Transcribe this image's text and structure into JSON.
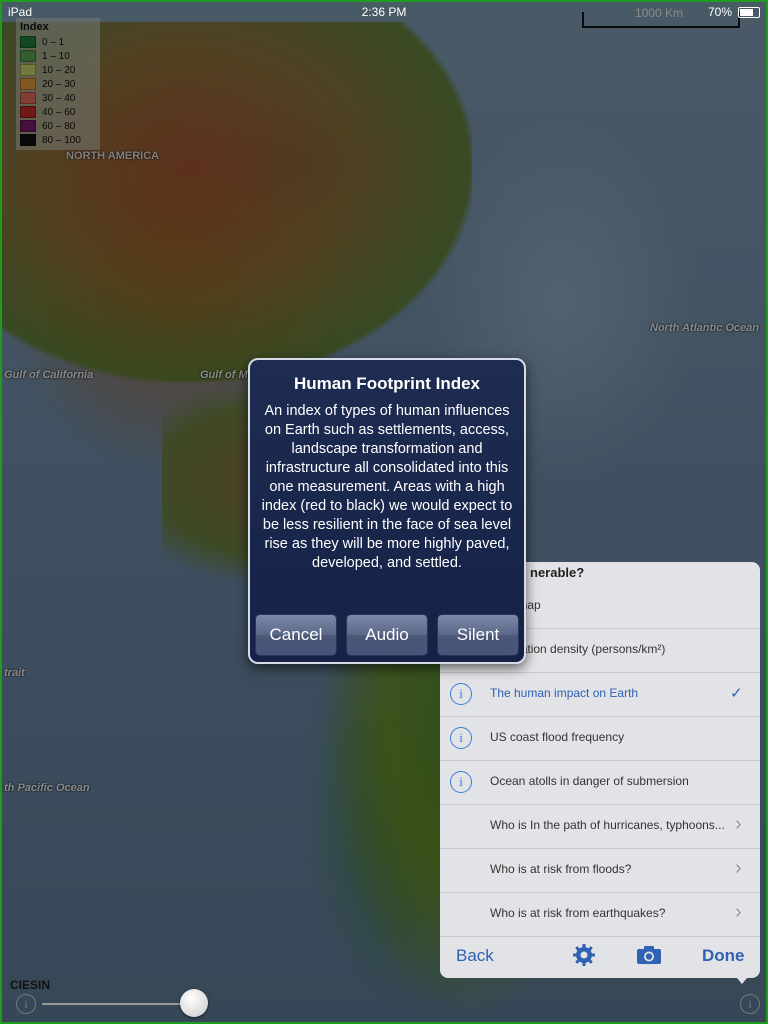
{
  "status_bar": {
    "carrier": "iPad",
    "time": "2:36 PM",
    "battery": "70%",
    "battery_level": 0.7
  },
  "scale_bar": {
    "label": "1000 Km"
  },
  "legend": {
    "title": "Index",
    "items": [
      {
        "label": "0 – 1",
        "color": "#1f7a3a"
      },
      {
        "label": "1 – 10",
        "color": "#5aa04a"
      },
      {
        "label": "10 – 20",
        "color": "#c8d26a"
      },
      {
        "label": "20 – 30",
        "color": "#e09a3a"
      },
      {
        "label": "30 – 40",
        "color": "#e06a5a"
      },
      {
        "label": "40 – 60",
        "color": "#c02a2a"
      },
      {
        "label": "60 – 80",
        "color": "#7a1a6a"
      },
      {
        "label": "80 – 100",
        "color": "#111111"
      }
    ]
  },
  "map_labels": {
    "north_america": "NORTH AMERICA",
    "north_atlantic": "North Atlantic Ocean",
    "gulf_california": "Gulf of California",
    "gulf_mexico": "Gulf of Me",
    "trait": "trait",
    "south_pacific": "th Pacific Ocean"
  },
  "alert": {
    "title": "Human Footprint Index",
    "message": "An index of types of human influences on Earth such as settlements, access, landscape transformation and infrastructure all consolidated into this one measurement. Areas with a high index (red to black) we would expect to be less resilient in the face of sea level rise as they will be more highly paved, developed, and settled.",
    "buttons": {
      "cancel": "Cancel",
      "audio": "Audio",
      "silent": "Silent"
    }
  },
  "panel": {
    "header": "nerable?",
    "rows": [
      {
        "label": "Basemap",
        "info": true
      },
      {
        "label": "Population density (persons/km²)",
        "info": true
      },
      {
        "label": "The human impact on Earth",
        "info": true,
        "selected": true
      },
      {
        "label": "US coast flood frequency",
        "info": true
      },
      {
        "label": "Ocean atolls in danger of submersion",
        "info": true
      },
      {
        "label": "Who is In the path of hurricanes, typhoons...",
        "disclosure": true
      },
      {
        "label": "Who is at risk from floods?",
        "disclosure": true
      },
      {
        "label": "Who is at risk from earthquakes?",
        "disclosure": true
      }
    ],
    "toolbar": {
      "back": "Back",
      "done": "Done",
      "settings_icon": "gear-icon",
      "camera_icon": "camera-icon"
    }
  },
  "bottom": {
    "credit": "CIESIN",
    "info_glyph": "i",
    "opacity_slider_value": 0.95
  },
  "glyphs": {
    "info": "i",
    "check": "✓",
    "chevron": "›"
  },
  "colors": {
    "accent": "#2f62b4",
    "alert_bg": "#1f2c52",
    "panel_bg": "#e2e3e6"
  }
}
